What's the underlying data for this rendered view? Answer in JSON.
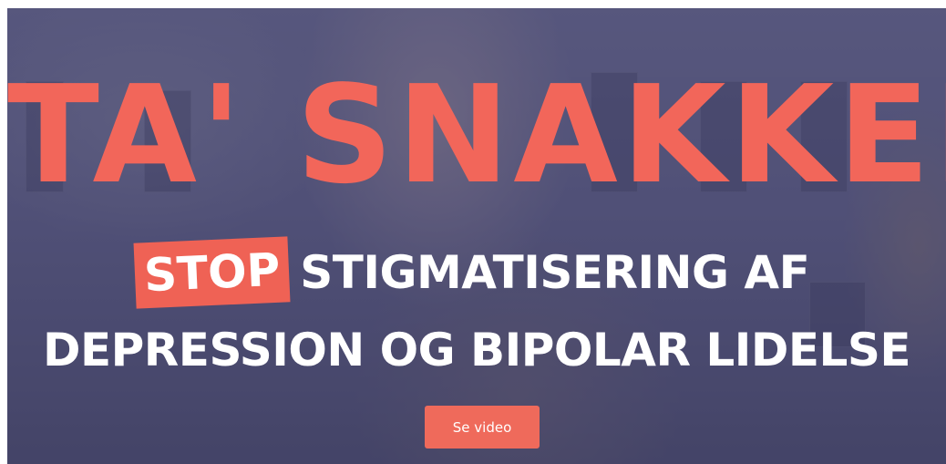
{
  "hero": {
    "headline": "TA' SNAKKEN",
    "stop_badge": "STOP",
    "subtitle_line1": "STIGMATISERING AF",
    "subtitle_line2": "DEPRESSION OG BIPOLAR LIDELSE",
    "cta_label": "Se video"
  },
  "colors": {
    "accent": "#ef6255",
    "headline": "#f2665a",
    "text": "#ffffff",
    "overlay": "#30305c"
  }
}
